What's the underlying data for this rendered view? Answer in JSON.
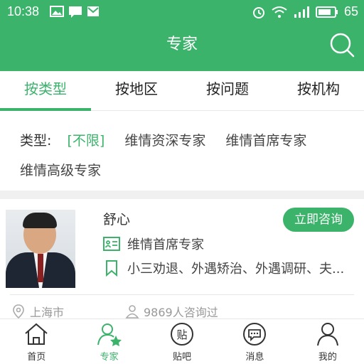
{
  "status": {
    "time": "10:38",
    "battery": "65"
  },
  "header": {
    "title": "专家",
    "search_icon": "search-icon"
  },
  "tabs": [
    {
      "label": "按类型"
    },
    {
      "label": "按地区"
    },
    {
      "label": "按问题"
    },
    {
      "label": "按机构"
    }
  ],
  "filter": {
    "label": "类型:",
    "options": [
      "[不限]",
      "维情资深专家",
      "维情首席专家",
      "维情高级专家"
    ]
  },
  "expert": {
    "name": "舒心",
    "consult_label": "立即咨询",
    "title": "维情首席专家",
    "specialties": "小三劝退、外遇矫治、外遇调研、夫...",
    "location": "上海市",
    "consult_count": "9869人咨询过"
  },
  "bottom_nav": [
    {
      "label": "首页"
    },
    {
      "label": "专家"
    },
    {
      "label": "贴吧"
    },
    {
      "label": "消息"
    },
    {
      "label": "我的"
    }
  ],
  "colors": {
    "accent": "#3bb36b"
  }
}
